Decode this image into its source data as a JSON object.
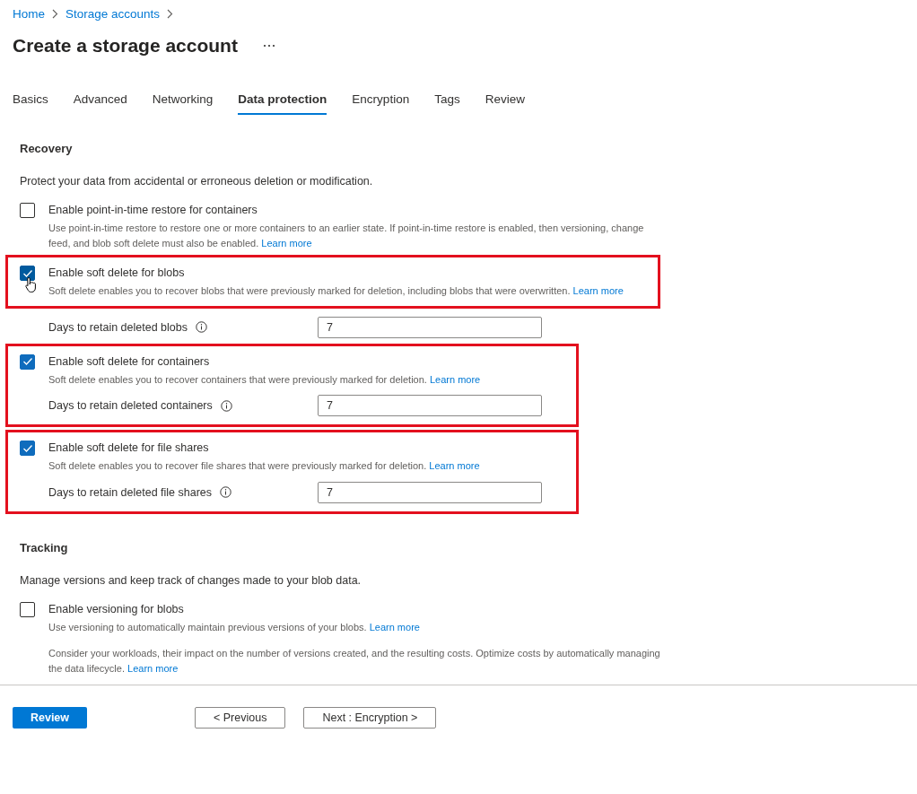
{
  "breadcrumb": [
    "Home",
    "Storage accounts"
  ],
  "title": "Create a storage account",
  "tabs": [
    {
      "label": "Basics",
      "selected": false
    },
    {
      "label": "Advanced",
      "selected": false
    },
    {
      "label": "Networking",
      "selected": false
    },
    {
      "label": "Data protection",
      "selected": true
    },
    {
      "label": "Encryption",
      "selected": false
    },
    {
      "label": "Tags",
      "selected": false
    },
    {
      "label": "Review",
      "selected": false
    }
  ],
  "sections": [
    {
      "heading": "Recovery",
      "description": "Protect your data from accidental or erroneous deletion or modification.",
      "groups": [
        {
          "highlighted": false,
          "items": [
            {
              "kind": "checkbox",
              "label": "Enable point-in-time restore for containers",
              "checked": false,
              "pointer": false,
              "description": "Use point-in-time restore to restore one or more containers to an earlier state. If point-in-time restore is enabled, then versioning, change feed, and blob soft delete must also be enabled.",
              "link": "Learn more"
            }
          ]
        },
        {
          "highlighted": true,
          "items": [
            {
              "kind": "checkbox",
              "label": "Enable soft delete for blobs",
              "checked": true,
              "pointer": true,
              "description": "Soft delete enables you to recover blobs that were previously marked for deletion, including blobs that were overwritten.",
              "link": "Learn more"
            }
          ]
        },
        {
          "highlighted": false,
          "items": [
            {
              "kind": "retention",
              "label": "Days to retain deleted blobs",
              "value": "7"
            }
          ]
        },
        {
          "highlighted": true,
          "items": [
            {
              "kind": "checkbox",
              "label": "Enable soft delete for containers",
              "checked": true,
              "pointer": false,
              "description": "Soft delete enables you to recover containers that were previously marked for deletion.",
              "link": "Learn more"
            },
            {
              "kind": "retention",
              "label": "Days to retain deleted containers",
              "value": "7"
            }
          ]
        },
        {
          "highlighted": true,
          "items": [
            {
              "kind": "checkbox",
              "label": "Enable soft delete for file shares",
              "checked": true,
              "pointer": false,
              "description": "Soft delete enables you to recover file shares that were previously marked for deletion.",
              "link": "Learn more"
            },
            {
              "kind": "retention",
              "label": "Days to retain deleted file shares",
              "value": "7"
            }
          ]
        }
      ]
    },
    {
      "heading": "Tracking",
      "description": "Manage versions and keep track of changes made to your blob data.",
      "groups": [
        {
          "highlighted": false,
          "items": [
            {
              "kind": "checkbox",
              "label": "Enable versioning for blobs",
              "checked": false,
              "pointer": false,
              "description": "Use versioning to automatically maintain previous versions of your blobs.",
              "link": "Learn more"
            },
            {
              "kind": "note",
              "description": "Consider your workloads, their impact on the number of versions created, and the resulting costs. Optimize costs by automatically managing the data lifecycle.",
              "link": "Learn more"
            }
          ]
        }
      ]
    }
  ],
  "footer_buttons": [
    {
      "label": "Review",
      "kind": "primary"
    },
    {
      "label": "< Previous",
      "kind": "secondary"
    },
    {
      "label": "Next : Encryption >",
      "kind": "secondary"
    }
  ]
}
